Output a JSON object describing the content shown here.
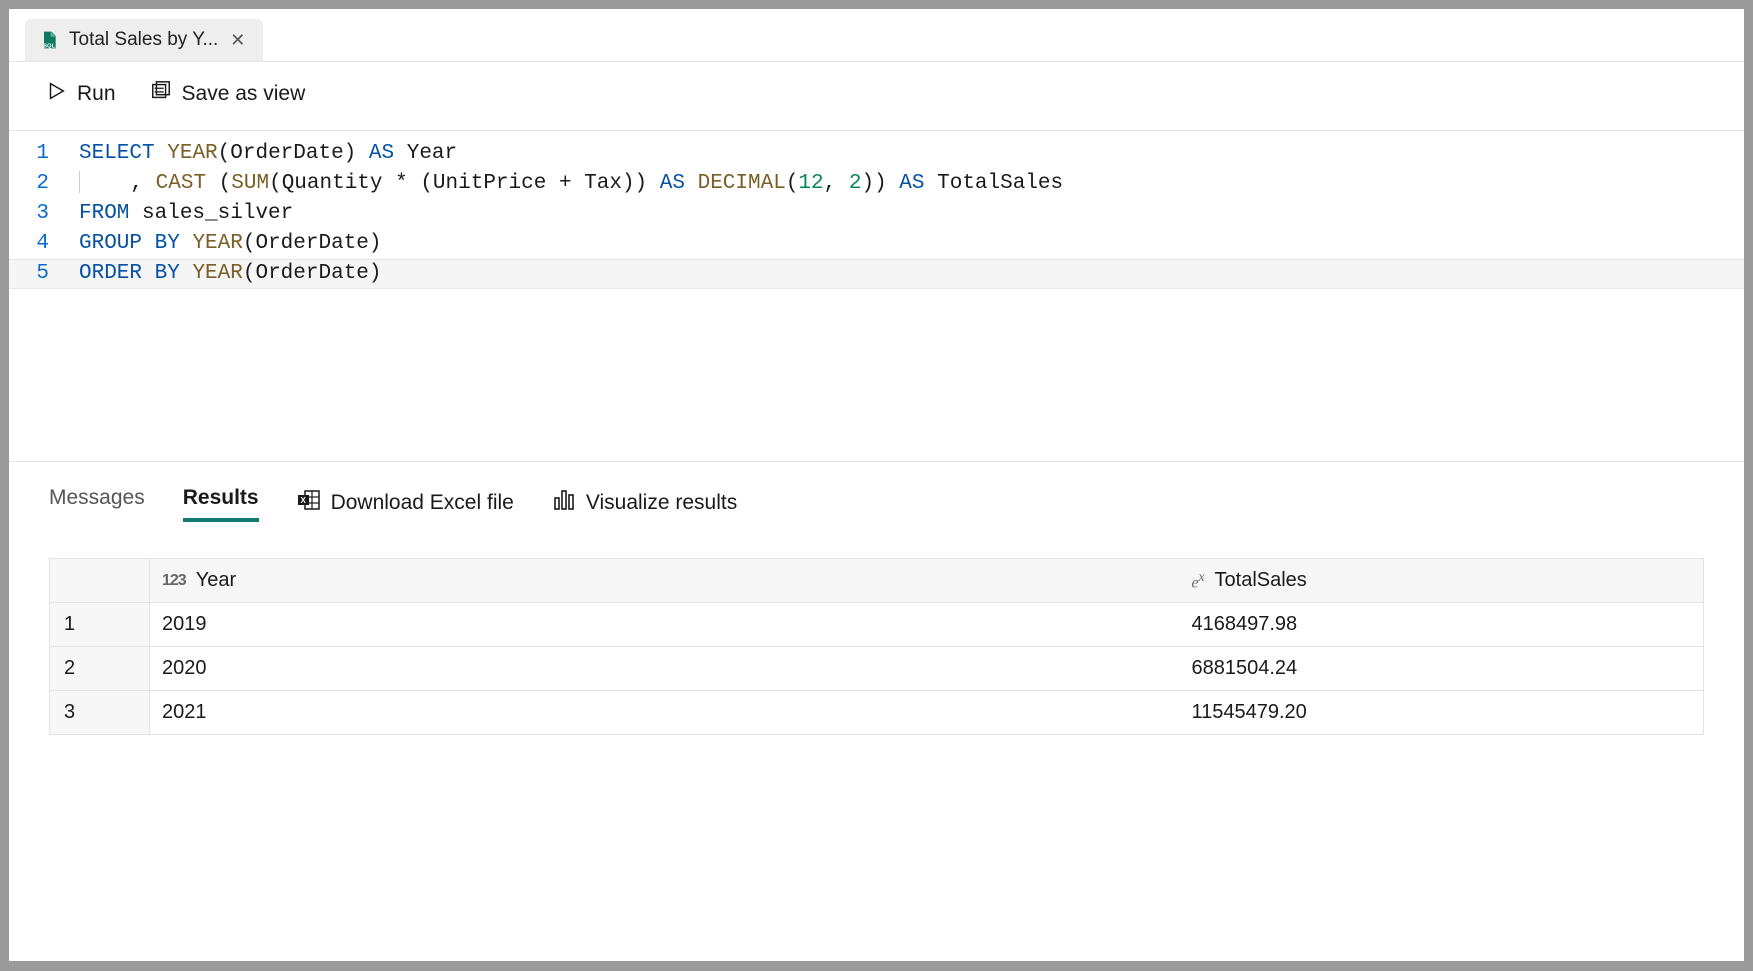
{
  "tab": {
    "title": "Total Sales by Y..."
  },
  "toolbar": {
    "run_label": "Run",
    "save_view_label": "Save as view"
  },
  "editor": {
    "lines": [
      {
        "n": "1",
        "tokens": [
          [
            "kw",
            "SELECT"
          ],
          [
            "sp",
            " "
          ],
          [
            "fn",
            "YEAR"
          ],
          [
            "",
            "(OrderDate) "
          ],
          [
            "kw",
            "AS"
          ],
          [
            "",
            " Year"
          ]
        ]
      },
      {
        "n": "2",
        "indent": true,
        "tokens": [
          [
            "",
            ", "
          ],
          [
            "fn",
            "CAST"
          ],
          [
            "",
            " ("
          ],
          [
            "fn",
            "SUM"
          ],
          [
            "",
            "(Quantity * (UnitPrice + Tax)) "
          ],
          [
            "kw",
            "AS"
          ],
          [
            "",
            " "
          ],
          [
            "fn",
            "DECIMAL"
          ],
          [
            "",
            "("
          ],
          [
            "num",
            "12"
          ],
          [
            "",
            ", "
          ],
          [
            "num",
            "2"
          ],
          [
            "",
            "))"
          ],
          [
            "",
            " "
          ],
          [
            "kw",
            "AS"
          ],
          [
            "",
            " TotalSales"
          ]
        ]
      },
      {
        "n": "3",
        "tokens": [
          [
            "kw",
            "FROM"
          ],
          [
            "",
            " sales_silver"
          ]
        ]
      },
      {
        "n": "4",
        "tokens": [
          [
            "kw",
            "GROUP"
          ],
          [
            "",
            " "
          ],
          [
            "kw",
            "BY"
          ],
          [
            "",
            " "
          ],
          [
            "fn",
            "YEAR"
          ],
          [
            "",
            "(OrderDate)"
          ]
        ]
      },
      {
        "n": "5",
        "current": true,
        "tokens": [
          [
            "kw",
            "ORDER"
          ],
          [
            "",
            " "
          ],
          [
            "kw",
            "BY"
          ],
          [
            "",
            " "
          ],
          [
            "fn",
            "YEAR"
          ],
          [
            "",
            "(OrderDate)"
          ]
        ]
      }
    ]
  },
  "results": {
    "tabs": {
      "messages": "Messages",
      "results": "Results",
      "download": "Download Excel file",
      "visualize": "Visualize results"
    },
    "columns": [
      {
        "name": "Year",
        "type": "123"
      },
      {
        "name": "TotalSales",
        "type": "ex"
      }
    ],
    "rows": [
      {
        "n": "1",
        "year": "2019",
        "total": "4168497.98"
      },
      {
        "n": "2",
        "year": "2020",
        "total": "6881504.24"
      },
      {
        "n": "3",
        "year": "2021",
        "total": "11545479.20"
      }
    ]
  }
}
